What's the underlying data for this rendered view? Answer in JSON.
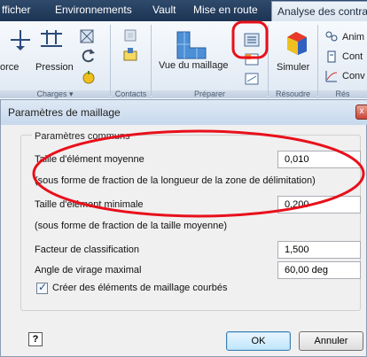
{
  "ribbon": {
    "tabs": [
      {
        "label": "fficher"
      },
      {
        "label": "Environnements"
      },
      {
        "label": "Vault"
      },
      {
        "label": "Mise en route"
      },
      {
        "label": "Analyse des contra"
      }
    ],
    "active_tab_index": 4,
    "buttons": {
      "force": "orce",
      "pression": "Pression",
      "vue_maillage": "Vue du maillage",
      "simuler": "Simuler",
      "anim": "Anim",
      "cont": "Cont",
      "conv": "Conv"
    },
    "groups": {
      "charges": "Charges ▾",
      "contacts": "Contacts",
      "preparer": "Préparer",
      "resoudre": "Résoudre",
      "res": "Rés"
    }
  },
  "dialog": {
    "title": "Paramètres de maillage",
    "close_symbol": "x",
    "group_title": "Paramètres communs",
    "params": [
      {
        "label": "Taille d'élément moyenne",
        "value": "0,010"
      },
      {
        "label": "(sous forme de fraction de la longueur de la zone de délimitation)"
      },
      {
        "label": "Taille d'élément minimale",
        "value": "0,200"
      },
      {
        "label": "(sous forme de fraction de la taille moyenne)"
      },
      {
        "label": "Facteur de classification",
        "value": "1,500"
      },
      {
        "label": "Angle de virage maximal",
        "value": "60,00 deg"
      }
    ],
    "checkbox": {
      "label": "Créer des éléments de maillage courbés",
      "checked": true
    },
    "help": "?",
    "ok": "OK",
    "cancel": "Annuler"
  },
  "colors": {
    "annotation": "#e8101b",
    "titlebar": "#1d3454",
    "dialog_bg": "#f0f0f0"
  }
}
